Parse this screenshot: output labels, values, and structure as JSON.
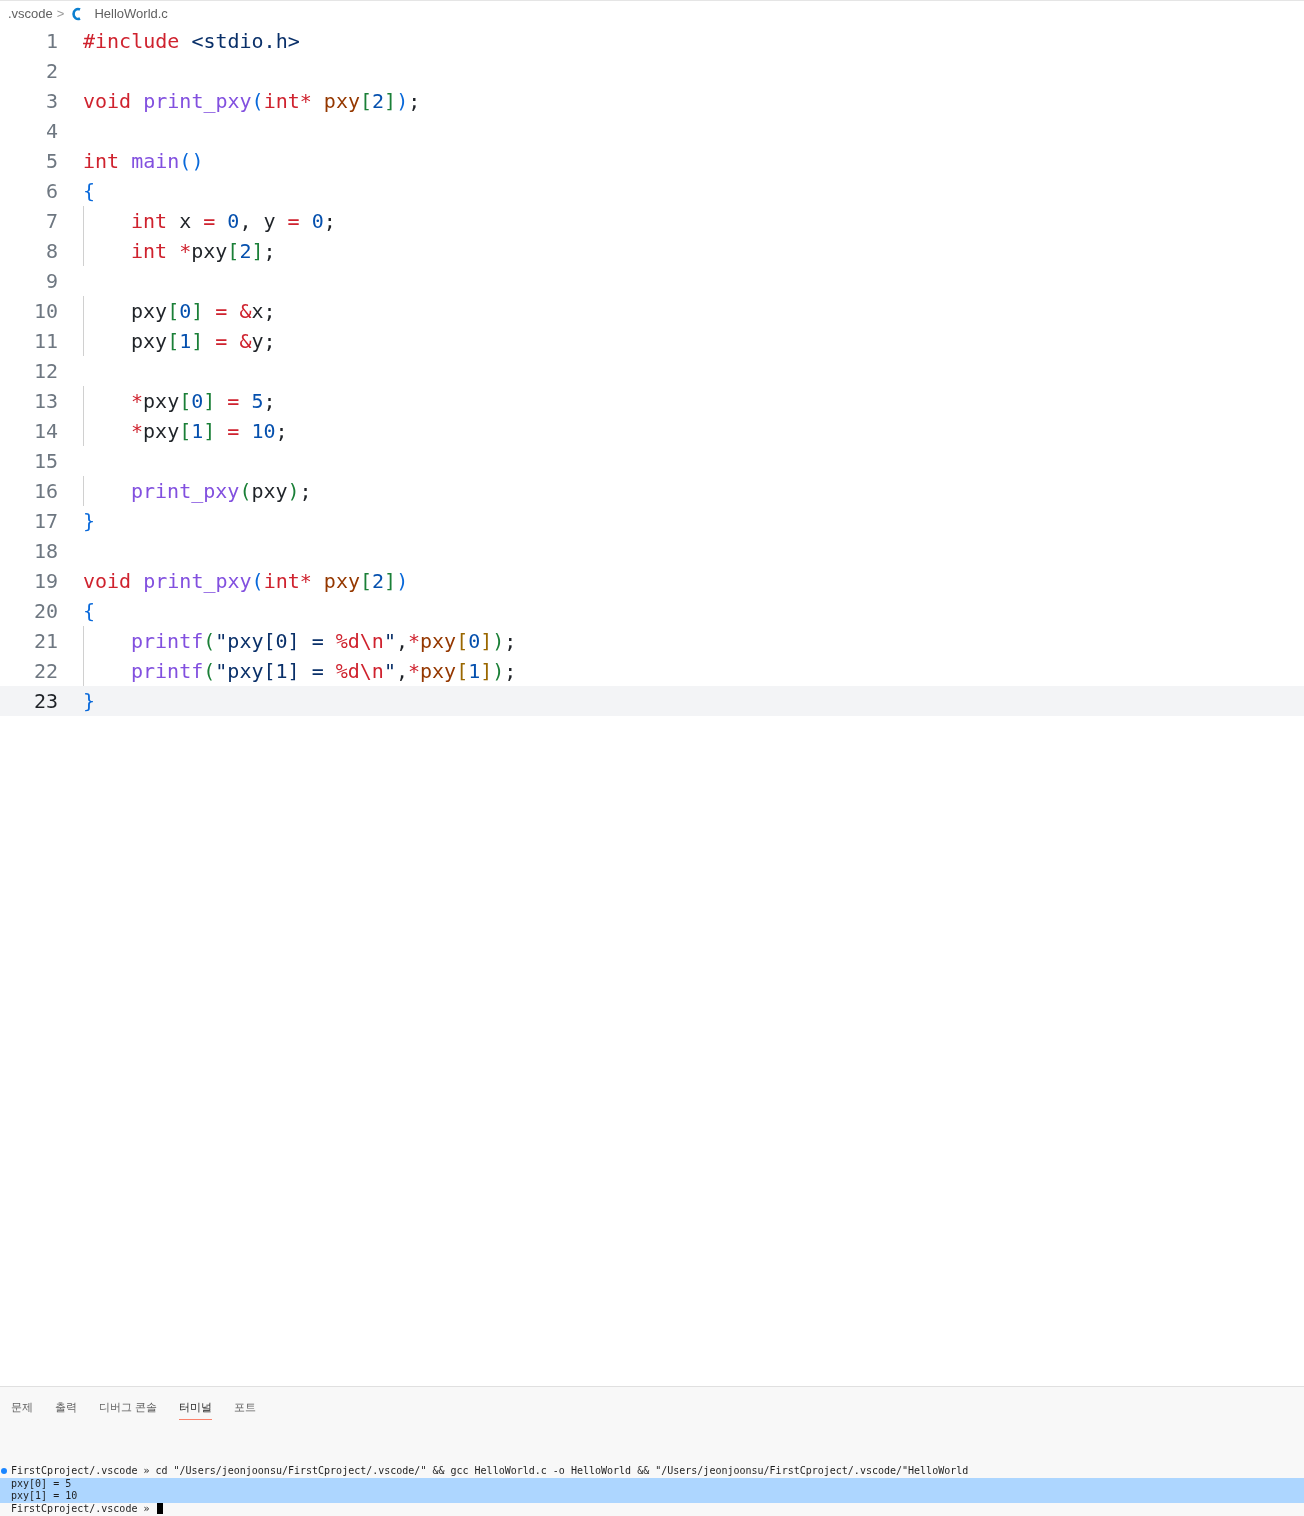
{
  "breadcrumb": {
    "folder": ".vscode",
    "separator": ">",
    "file": "HelloWorld.c"
  },
  "editor": {
    "lines": [
      {
        "number": "1",
        "current": false,
        "indented": false,
        "tokens": [
          {
            "text": "#include ",
            "kind": "kw"
          },
          {
            "text": "<stdio.h>",
            "kind": "str"
          }
        ]
      },
      {
        "number": "2",
        "current": false,
        "indented": false
      },
      {
        "number": "3",
        "current": false,
        "indented": false,
        "tokens": [
          {
            "text": "void ",
            "kind": "kw"
          },
          {
            "text": "print_pxy",
            "kind": "fn"
          },
          {
            "text": "(",
            "kind": "b1"
          },
          {
            "text": "int* ",
            "kind": "kw"
          },
          {
            "text": "pxy",
            "kind": "param"
          },
          {
            "text": "[",
            "kind": "b2"
          },
          {
            "text": "2",
            "kind": "num"
          },
          {
            "text": "]",
            "kind": "b2"
          },
          {
            "text": ")",
            "kind": "b1"
          },
          {
            "text": ";",
            "kind": "plain"
          }
        ]
      },
      {
        "number": "4",
        "current": false,
        "indented": false
      },
      {
        "number": "5",
        "current": false,
        "indented": false,
        "tokens": [
          {
            "text": "int ",
            "kind": "kw"
          },
          {
            "text": "main",
            "kind": "fn"
          },
          {
            "text": "()",
            "kind": "b1"
          }
        ]
      },
      {
        "number": "6",
        "current": false,
        "indented": false,
        "tokens": [
          {
            "text": "{",
            "kind": "b1"
          }
        ]
      },
      {
        "number": "7",
        "current": false,
        "indented": true,
        "tokens": [
          {
            "text": "int ",
            "kind": "kw"
          },
          {
            "text": "x ",
            "kind": "plain"
          },
          {
            "text": "= ",
            "kind": "op"
          },
          {
            "text": "0",
            "kind": "num"
          },
          {
            "text": ", y ",
            "kind": "plain"
          },
          {
            "text": "= ",
            "kind": "op"
          },
          {
            "text": "0",
            "kind": "num"
          },
          {
            "text": ";",
            "kind": "plain"
          }
        ]
      },
      {
        "number": "8",
        "current": false,
        "indented": true,
        "tokens": [
          {
            "text": "int ",
            "kind": "kw"
          },
          {
            "text": "*",
            "kind": "op"
          },
          {
            "text": "pxy",
            "kind": "plain"
          },
          {
            "text": "[",
            "kind": "b2"
          },
          {
            "text": "2",
            "kind": "num"
          },
          {
            "text": "]",
            "kind": "b2"
          },
          {
            "text": ";",
            "kind": "plain"
          }
        ]
      },
      {
        "number": "9",
        "current": false,
        "indented": false
      },
      {
        "number": "10",
        "current": false,
        "indented": true,
        "tokens": [
          {
            "text": "pxy",
            "kind": "plain"
          },
          {
            "text": "[",
            "kind": "b2"
          },
          {
            "text": "0",
            "kind": "num"
          },
          {
            "text": "] ",
            "kind": "b2"
          },
          {
            "text": "= &",
            "kind": "op"
          },
          {
            "text": "x;",
            "kind": "plain"
          }
        ]
      },
      {
        "number": "11",
        "current": false,
        "indented": true,
        "tokens": [
          {
            "text": "pxy",
            "kind": "plain"
          },
          {
            "text": "[",
            "kind": "b2"
          },
          {
            "text": "1",
            "kind": "num"
          },
          {
            "text": "] ",
            "kind": "b2"
          },
          {
            "text": "= &",
            "kind": "op"
          },
          {
            "text": "y;",
            "kind": "plain"
          }
        ]
      },
      {
        "number": "12",
        "current": false,
        "indented": false
      },
      {
        "number": "13",
        "current": false,
        "indented": true,
        "tokens": [
          {
            "text": "*",
            "kind": "op"
          },
          {
            "text": "pxy",
            "kind": "plain"
          },
          {
            "text": "[",
            "kind": "b2"
          },
          {
            "text": "0",
            "kind": "num"
          },
          {
            "text": "] ",
            "kind": "b2"
          },
          {
            "text": "= ",
            "kind": "op"
          },
          {
            "text": "5",
            "kind": "num"
          },
          {
            "text": ";",
            "kind": "plain"
          }
        ]
      },
      {
        "number": "14",
        "current": false,
        "indented": true,
        "tokens": [
          {
            "text": "*",
            "kind": "op"
          },
          {
            "text": "pxy",
            "kind": "plain"
          },
          {
            "text": "[",
            "kind": "b2"
          },
          {
            "text": "1",
            "kind": "num"
          },
          {
            "text": "] ",
            "kind": "b2"
          },
          {
            "text": "= ",
            "kind": "op"
          },
          {
            "text": "10",
            "kind": "num"
          },
          {
            "text": ";",
            "kind": "plain"
          }
        ]
      },
      {
        "number": "15",
        "current": false,
        "indented": false
      },
      {
        "number": "16",
        "current": false,
        "indented": true,
        "tokens": [
          {
            "text": "print_pxy",
            "kind": "fn"
          },
          {
            "text": "(",
            "kind": "b2"
          },
          {
            "text": "pxy",
            "kind": "plain"
          },
          {
            "text": ")",
            "kind": "b2"
          },
          {
            "text": ";",
            "kind": "plain"
          }
        ]
      },
      {
        "number": "17",
        "current": false,
        "indented": false,
        "tokens": [
          {
            "text": "}",
            "kind": "b1"
          }
        ]
      },
      {
        "number": "18",
        "current": false,
        "indented": false
      },
      {
        "number": "19",
        "current": false,
        "indented": false,
        "tokens": [
          {
            "text": "void ",
            "kind": "kw"
          },
          {
            "text": "print_pxy",
            "kind": "fn"
          },
          {
            "text": "(",
            "kind": "b1"
          },
          {
            "text": "int* ",
            "kind": "kw"
          },
          {
            "text": "pxy",
            "kind": "param"
          },
          {
            "text": "[",
            "kind": "b2"
          },
          {
            "text": "2",
            "kind": "num"
          },
          {
            "text": "]",
            "kind": "b2"
          },
          {
            "text": ")",
            "kind": "b1"
          }
        ]
      },
      {
        "number": "20",
        "current": false,
        "indented": false,
        "tokens": [
          {
            "text": "{",
            "kind": "b1"
          }
        ]
      },
      {
        "number": "21",
        "current": false,
        "indented": true,
        "tokens": [
          {
            "text": "printf",
            "kind": "fn"
          },
          {
            "text": "(",
            "kind": "b2"
          },
          {
            "text": "\"pxy[0] = ",
            "kind": "str"
          },
          {
            "text": "%d\\n",
            "kind": "op"
          },
          {
            "text": "\"",
            "kind": "str"
          },
          {
            "text": ",",
            "kind": "plain"
          },
          {
            "text": "*",
            "kind": "op"
          },
          {
            "text": "pxy",
            "kind": "param"
          },
          {
            "text": "[",
            "kind": "b3"
          },
          {
            "text": "0",
            "kind": "num"
          },
          {
            "text": "]",
            "kind": "b3"
          },
          {
            "text": ")",
            "kind": "b2"
          },
          {
            "text": ";",
            "kind": "plain"
          }
        ]
      },
      {
        "number": "22",
        "current": false,
        "indented": true,
        "tokens": [
          {
            "text": "printf",
            "kind": "fn"
          },
          {
            "text": "(",
            "kind": "b2"
          },
          {
            "text": "\"pxy[1] = ",
            "kind": "str"
          },
          {
            "text": "%d\\n",
            "kind": "op"
          },
          {
            "text": "\"",
            "kind": "str"
          },
          {
            "text": ",",
            "kind": "plain"
          },
          {
            "text": "*",
            "kind": "op"
          },
          {
            "text": "pxy",
            "kind": "param"
          },
          {
            "text": "[",
            "kind": "b3"
          },
          {
            "text": "1",
            "kind": "num"
          },
          {
            "text": "]",
            "kind": "b3"
          },
          {
            "text": ")",
            "kind": "b2"
          },
          {
            "text": ";",
            "kind": "plain"
          }
        ]
      },
      {
        "number": "23",
        "current": true,
        "indented": false,
        "tokens": [
          {
            "text": "}",
            "kind": "b1"
          }
        ]
      }
    ]
  },
  "panel": {
    "tabs": [
      {
        "label": "문제",
        "selected": false
      },
      {
        "label": "출력",
        "selected": false
      },
      {
        "label": "디버그 콘솔",
        "selected": false
      },
      {
        "label": "터미널",
        "selected": true
      },
      {
        "label": "포트",
        "selected": false
      }
    ],
    "terminal": [
      {
        "kind": "command",
        "selected": false,
        "text": "FirstCproject/.vscode » cd \"/Users/jeonjoonsu/FirstCproject/.vscode/\" && gcc HelloWorld.c -o HelloWorld && \"/Users/jeonjoonsu/FirstCproject/.vscode/\"HelloWorld"
      },
      {
        "kind": "output",
        "selected": true,
        "text": "pxy[0] = 5"
      },
      {
        "kind": "output",
        "selected": true,
        "text": "pxy[1] = 10"
      },
      {
        "kind": "prompt",
        "selected": false,
        "text": "FirstCproject/.vscode »"
      }
    ]
  }
}
